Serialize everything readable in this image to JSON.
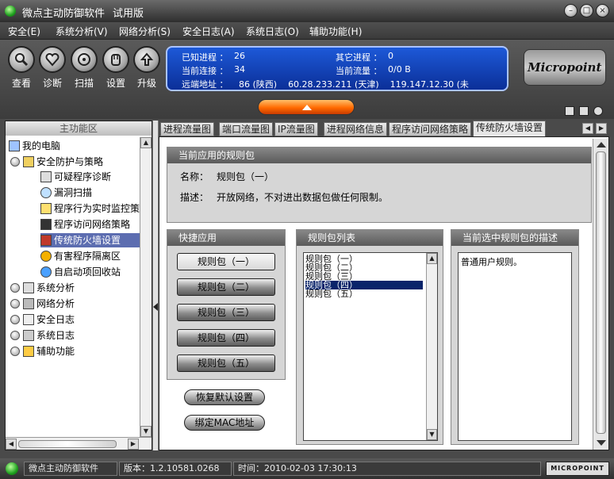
{
  "window": {
    "title": "微点主动防御软件",
    "mode": "试用版"
  },
  "menu": [
    "安全(E)",
    "系统分析(V)",
    "网络分析(S)",
    "安全日志(A)",
    "系统日志(O)",
    "辅助功能(H)"
  ],
  "toolbar": {
    "view": "查看",
    "diagnose": "诊断",
    "scan": "扫描",
    "settings": "设置",
    "upgrade": "升级"
  },
  "info": {
    "known_label": "已知进程 ：",
    "known_value": "26",
    "other_label": "其它进程 ：",
    "other_value": "0",
    "conn_label": "当前连接 ：",
    "conn_value": "34",
    "flow_label": "当前流量 ：",
    "flow_value": "0/0 B",
    "remote_label": "远端地址 ：",
    "remote_value": "86 (陕西)    60.28.233.211 (天津)    119.147.12.30 (未"
  },
  "logo": "Micropoint",
  "sidebar": {
    "title": "主功能区",
    "items": [
      "我的电脑",
      "安全防护与策略",
      "可疑程序诊断",
      "漏洞扫描",
      "程序行为实时监控策",
      "程序访问网络策略",
      "传统防火墙设置",
      "有害程序隔离区",
      "自启动项回收站",
      "系统分析",
      "网络分析",
      "安全日志",
      "系统日志",
      "辅助功能"
    ]
  },
  "tabs": [
    "进程流量图",
    "端口流量图",
    "IP流量图",
    "进程网络信息",
    "程序访问网络策略",
    "传统防火墙设置"
  ],
  "current_rule": {
    "title": "当前应用的规则包",
    "name_label": "名称：",
    "name_value": "规则包（一）",
    "desc_label": "描述：",
    "desc_value": "开放网络，不对进出数据包做任何限制。"
  },
  "quick_apply": {
    "title": "快捷应用",
    "buttons": [
      "规则包（一）",
      "规则包（二）",
      "规则包（三）",
      "规则包（四）",
      "规则包（五）"
    ]
  },
  "rule_list": {
    "title": "规则包列表",
    "items": [
      "规则包（一）",
      "规则包（二）",
      "规则包（三）",
      "规则包（四）",
      "规则包（五）"
    ],
    "selected_index": 3
  },
  "selected_desc": {
    "title": "当前选中规则包的描述",
    "text": "普通用户规则。"
  },
  "actions": {
    "restore": "恢复默认设置",
    "bind_mac": "绑定MAC地址"
  },
  "status": {
    "app": "微点主动防御软件",
    "version": "版本：1.2.10581.0268",
    "time": "时间：2010-02-03 17:30:13",
    "badge": "MICROPOINT"
  },
  "colors": {
    "info_panel": "#1d59d8",
    "accent_orange": "#ff6a00",
    "selection": "#0a246a"
  }
}
